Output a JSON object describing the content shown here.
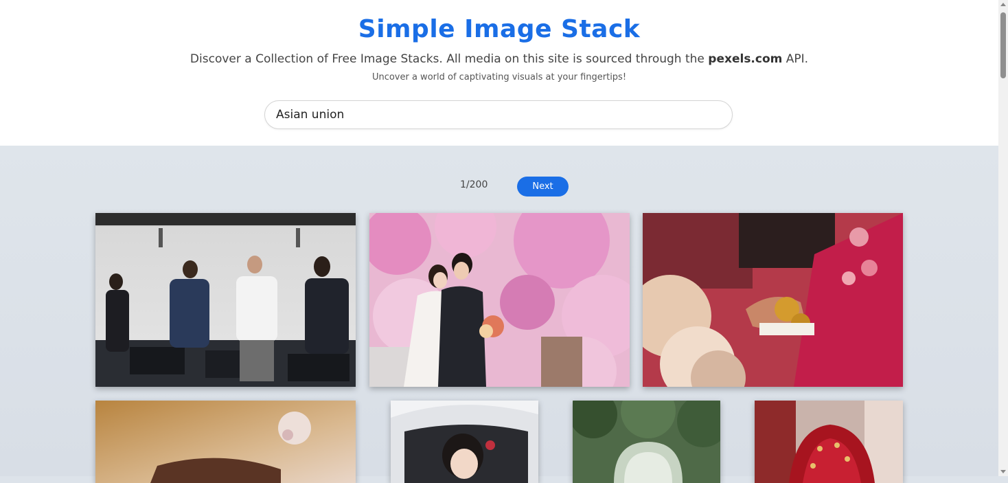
{
  "header": {
    "title": "Simple Image Stack",
    "subtitle_prefix": "Discover a Collection of Free Image Stacks. All media on this site is sourced through the ",
    "subtitle_brand": "pexels.com",
    "subtitle_suffix": " API.",
    "tagline": "Uncover a world of captivating visuals at your fingertips!"
  },
  "search": {
    "value": "Asian union"
  },
  "pagination": {
    "page_count": "1/200",
    "next_label": "Next"
  },
  "gallery": {
    "photos": [
      {
        "name": "office-team-celebrating-photo"
      },
      {
        "name": "couple-cherry-blossom-photo"
      },
      {
        "name": "bride-hands-henna-photo"
      },
      {
        "name": "hands-closeup-photo"
      },
      {
        "name": "bride-in-car-photo"
      },
      {
        "name": "garden-arch-photo"
      },
      {
        "name": "bride-red-veil-photo"
      }
    ]
  },
  "colors": {
    "accent": "#1a6ee6",
    "background": "#dde3ea"
  }
}
